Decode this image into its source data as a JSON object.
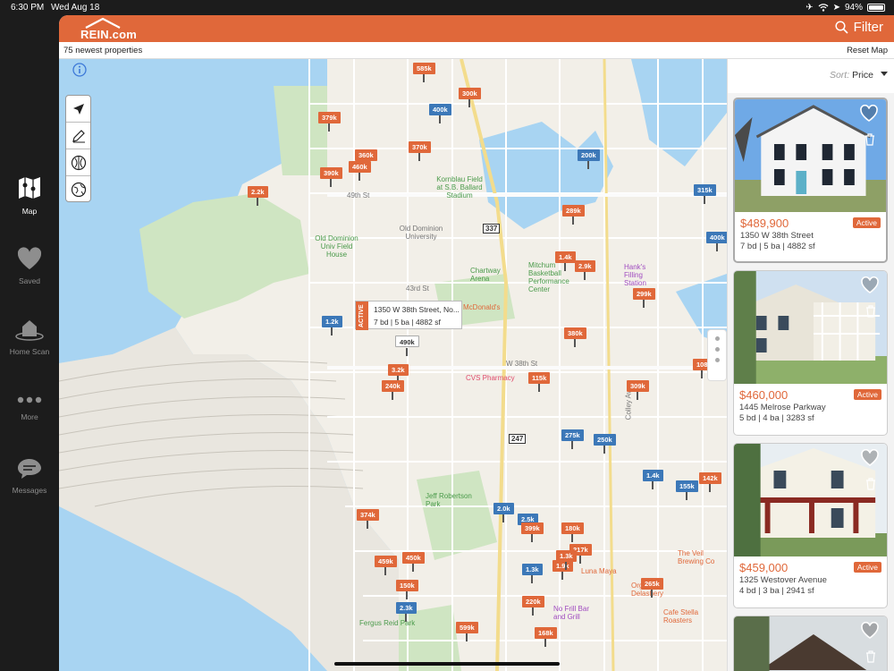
{
  "status": {
    "time": "6:30 PM",
    "date": "Wed Aug 18",
    "battery": "94%"
  },
  "sidebar": {
    "items": [
      {
        "label": "Map",
        "icon": "map-icon",
        "active": true
      },
      {
        "label": "Saved",
        "icon": "heart-icon"
      },
      {
        "label": "Home Scan",
        "icon": "home-scan-icon"
      },
      {
        "label": "More",
        "icon": "more-icon"
      },
      {
        "label": "Messages",
        "icon": "messages-icon"
      }
    ]
  },
  "header": {
    "logo": "REIN.com",
    "filter": "Filter"
  },
  "subbar": {
    "count": "75 newest properties",
    "reset": "Reset Map"
  },
  "list": {
    "sort_label": "Sort:",
    "sort_value": "Price",
    "cards": [
      {
        "price": "$489,900",
        "status": "Active",
        "address": "1350 W 38th Street",
        "details": "7 bd | 5 ba | 4882 sf"
      },
      {
        "price": "$460,000",
        "status": "Active",
        "address": "1445 Melrose Parkway",
        "details": "5 bd | 4 ba | 3283 sf"
      },
      {
        "price": "$459,000",
        "status": "Active",
        "address": "1325 Westover Avenue",
        "details": "4 bd | 3 ba | 2941 sf"
      }
    ]
  },
  "popup": {
    "status": "ACTIVE",
    "address": "1350 W 38th Street, No...",
    "details": "7 bd | 5 ba | 4882 sf",
    "pin": "490k"
  },
  "map_labels": {
    "kornblau": "Kornblau Field at S.B. Ballard Stadium",
    "odu": "Old Dominion University",
    "odu_field": "Old Dominion Univ Field House",
    "chartway": "Chartway Arena",
    "mitchum": "Mitchum Basketball Performance Center",
    "hanks": "Hank's Filling Station",
    "mcdonalds": "McDonald's",
    "cvs": "CVS Pharmacy",
    "jeff": "Jeff Robertson Park",
    "fergus": "Fergus Reid Park",
    "nofrill": "No Frill Bar and Grill",
    "luna": "Luna Maya",
    "veil": "The Veil Brewing Co",
    "stella": "Cafe Stella Roasters",
    "gorgos": "Orgo's Delashery",
    "st49": "49th St",
    "st43": "43rd St",
    "w38": "W 38th St",
    "colley": "Colley Ave",
    "r337": "337",
    "r247": "247"
  },
  "pins": [
    {
      "label": "585k",
      "c": "o"
    },
    {
      "label": "300k",
      "c": "o"
    },
    {
      "label": "400k",
      "c": "b"
    },
    {
      "label": "379k",
      "c": "o"
    },
    {
      "label": "370k",
      "c": "o"
    },
    {
      "label": "360k",
      "c": "o"
    },
    {
      "label": "460k",
      "c": "o"
    },
    {
      "label": "390k",
      "c": "o"
    },
    {
      "label": "200k",
      "c": "b"
    },
    {
      "label": "2.2k",
      "c": "o"
    },
    {
      "label": "315k",
      "c": "b"
    },
    {
      "label": "289k",
      "c": "o"
    },
    {
      "label": "400k",
      "c": "b"
    },
    {
      "label": "1.4k",
      "c": "o"
    },
    {
      "label": "2.9k",
      "c": "o"
    },
    {
      "label": "299k",
      "c": "o"
    },
    {
      "label": "1.2k",
      "c": "b"
    },
    {
      "label": "380k",
      "c": "o"
    },
    {
      "label": "3.2k",
      "c": "o"
    },
    {
      "label": "115k",
      "c": "o"
    },
    {
      "label": "240k",
      "c": "o"
    },
    {
      "label": "309k",
      "c": "o"
    },
    {
      "label": "108",
      "c": "o"
    },
    {
      "label": "275k",
      "c": "b"
    },
    {
      "label": "250k",
      "c": "b"
    },
    {
      "label": "1.4k",
      "c": "b"
    },
    {
      "label": "155k",
      "c": "b"
    },
    {
      "label": "142k",
      "c": "o"
    },
    {
      "label": "2.0k",
      "c": "b"
    },
    {
      "label": "2.5k",
      "c": "b"
    },
    {
      "label": "374k",
      "c": "o"
    },
    {
      "label": "399k",
      "c": "o"
    },
    {
      "label": "180k",
      "c": "o"
    },
    {
      "label": "217k",
      "c": "o"
    },
    {
      "label": "1.3k",
      "c": "b"
    },
    {
      "label": "1.9k",
      "c": "o"
    },
    {
      "label": "1.3k",
      "c": "o"
    },
    {
      "label": "459k",
      "c": "o"
    },
    {
      "label": "450k",
      "c": "o"
    },
    {
      "label": "265k",
      "c": "o"
    },
    {
      "label": "150k",
      "c": "o"
    },
    {
      "label": "220k",
      "c": "o"
    },
    {
      "label": "2.3k",
      "c": "b"
    },
    {
      "label": "599k",
      "c": "o"
    },
    {
      "label": "168k",
      "c": "o"
    }
  ]
}
